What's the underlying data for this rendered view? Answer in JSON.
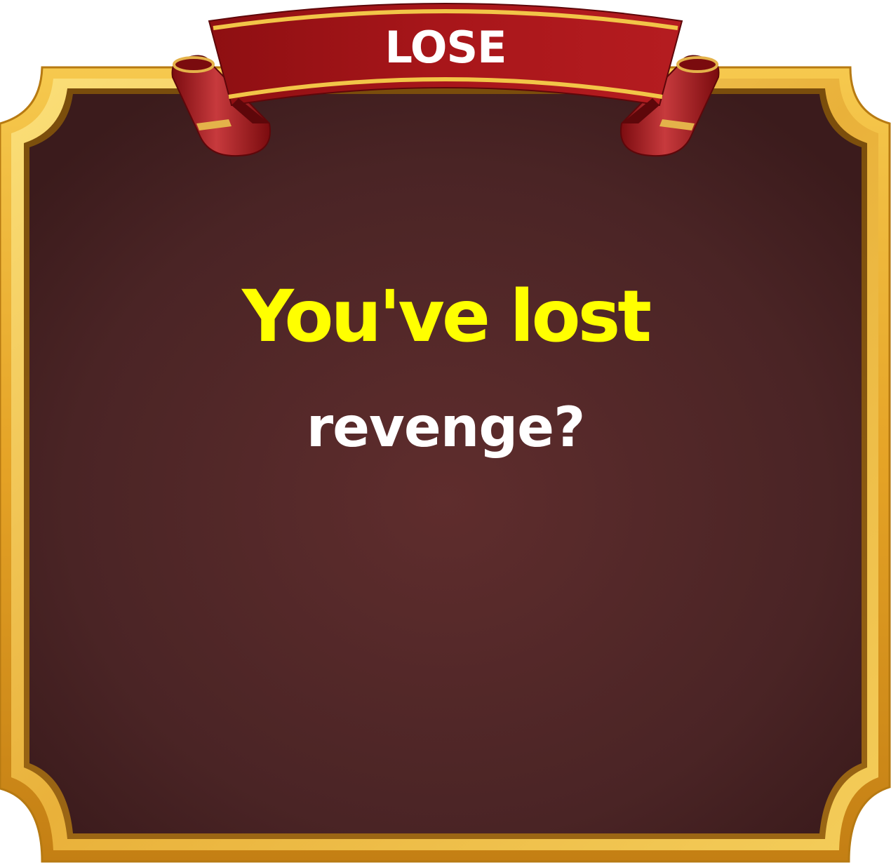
{
  "dialog": {
    "banner_label": "LOSE",
    "headline": "You've lost",
    "prompt": "revenge?"
  },
  "colors": {
    "frame_gold": "#e8a72a",
    "frame_gold_light": "#f7d667",
    "frame_gold_dark": "#8a5a10",
    "panel_center": "#5e2c2c",
    "panel_edge": "#3a1c1e",
    "ribbon_red": "#b3191c",
    "ribbon_dark_red": "#7a0b0e",
    "headline_color": "#ffff00",
    "prompt_color": "#ffffff"
  },
  "icons": [
    "ribbon-banner",
    "gold-frame"
  ]
}
